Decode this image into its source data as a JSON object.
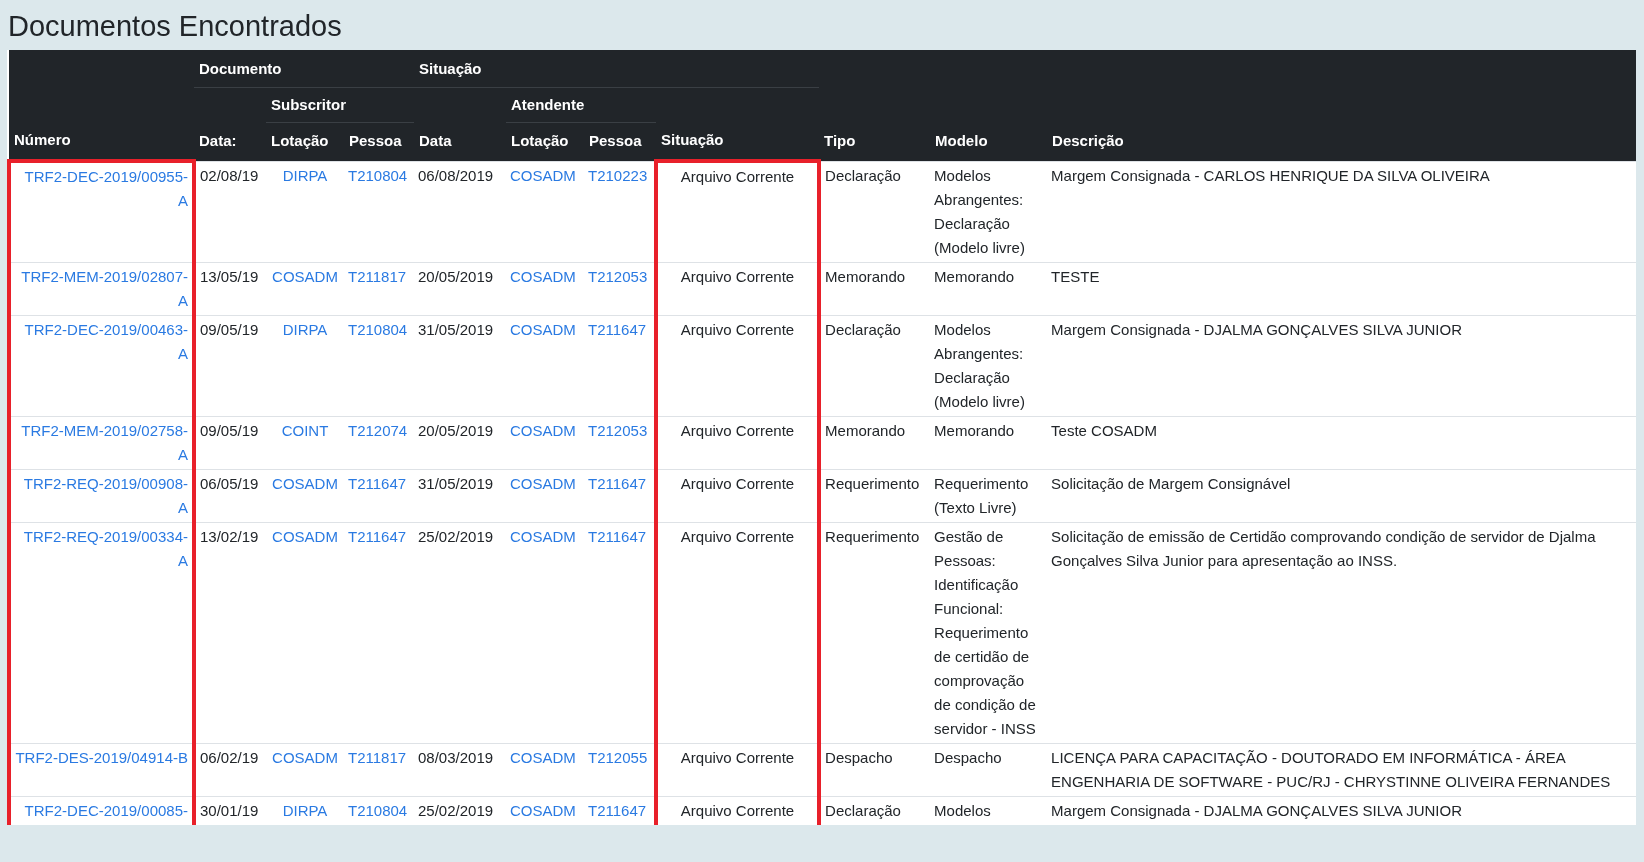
{
  "title": "Documentos Encontrados",
  "header": {
    "documento": "Documento",
    "situacao": "Situação",
    "subscritor": "Subscritor",
    "atendente": "Atendente"
  },
  "columns": [
    {
      "label": "Número",
      "kind": "link",
      "highlighted": true
    },
    {
      "label": "Data:",
      "kind": "text",
      "highlighted": false
    },
    {
      "label": "Lotação",
      "kind": "link",
      "highlighted": false
    },
    {
      "label": "Pessoa",
      "kind": "link",
      "highlighted": false
    },
    {
      "label": "Data",
      "kind": "text",
      "highlighted": false
    },
    {
      "label": "Lotação",
      "kind": "link",
      "highlighted": false
    },
    {
      "label": "Pessoa",
      "kind": "link",
      "highlighted": false
    },
    {
      "label": "Situação",
      "kind": "text",
      "highlighted": true
    },
    {
      "label": "Tipo",
      "kind": "text",
      "highlighted": false
    },
    {
      "label": "Modelo",
      "kind": "text",
      "highlighted": false
    },
    {
      "label": "Descrição",
      "kind": "text",
      "highlighted": false
    }
  ],
  "rows": [
    {
      "cells": [
        "TRF2-DEC-2019/00955-A",
        "02/08/19",
        "DIRPA",
        "T210804",
        "06/08/2019",
        "COSADM",
        "T210223",
        "Arquivo Corrente",
        "Declaração",
        "Modelos Abrangentes: Declaração (Modelo livre)",
        "Margem Consignada - CARLOS HENRIQUE DA SILVA OLIVEIRA"
      ]
    },
    {
      "cells": [
        "TRF2-MEM-2019/02807-A",
        "13/05/19",
        "COSADM",
        "T211817",
        "20/05/2019",
        "COSADM",
        "T212053",
        "Arquivo Corrente",
        "Memorando",
        "Memorando",
        "TESTE"
      ]
    },
    {
      "cells": [
        "TRF2-DEC-2019/00463-A",
        "09/05/19",
        "DIRPA",
        "T210804",
        "31/05/2019",
        "COSADM",
        "T211647",
        "Arquivo Corrente",
        "Declaração",
        "Modelos Abrangentes: Declaração (Modelo livre)",
        "Margem Consignada - DJALMA GONÇALVES SILVA JUNIOR"
      ]
    },
    {
      "cells": [
        "TRF2-MEM-2019/02758-A",
        "09/05/19",
        "COINT",
        "T212074",
        "20/05/2019",
        "COSADM",
        "T212053",
        "Arquivo Corrente",
        "Memorando",
        "Memorando",
        "Teste COSADM"
      ]
    },
    {
      "cells": [
        "TRF2-REQ-2019/00908-A",
        "06/05/19",
        "COSADM",
        "T211647",
        "31/05/2019",
        "COSADM",
        "T211647",
        "Arquivo Corrente",
        "Requerimento",
        "Requerimento (Texto Livre)",
        "Solicitação de Margem Consignável"
      ]
    },
    {
      "cells": [
        "TRF2-REQ-2019/00334-A",
        "13/02/19",
        "COSADM",
        "T211647",
        "25/02/2019",
        "COSADM",
        "T211647",
        "Arquivo Corrente",
        "Requerimento",
        "Gestão de Pessoas: Identificação Funcional: Requerimento de certidão de comprovação de condição de servidor - INSS",
        "Solicitação de emissão de Certidão comprovando condição de servidor de Djalma Gonçalves Silva Junior para apresentação ao INSS."
      ]
    },
    {
      "cells": [
        "TRF2-DES-2019/04914-B",
        "06/02/19",
        "COSADM",
        "T211817",
        "08/03/2019",
        "COSADM",
        "T212055",
        "Arquivo Corrente",
        "Despacho",
        "Despacho",
        "LICENÇA PARA CAPACITAÇÃO - DOUTORADO EM INFORMÁTICA - ÁREA ENGENHARIA DE SOFTWARE - PUC/RJ - CHRYSTINNE OLIVEIRA FERNANDES"
      ]
    },
    {
      "cells": [
        "TRF2-DEC-2019/00085-",
        "30/01/19",
        "DIRPA",
        "T210804",
        "25/02/2019",
        "COSADM",
        "T211647",
        "Arquivo Corrente",
        "Declaração",
        "Modelos",
        "Margem Consignada - DJALMA GONÇALVES SILVA JUNIOR"
      ]
    }
  ]
}
